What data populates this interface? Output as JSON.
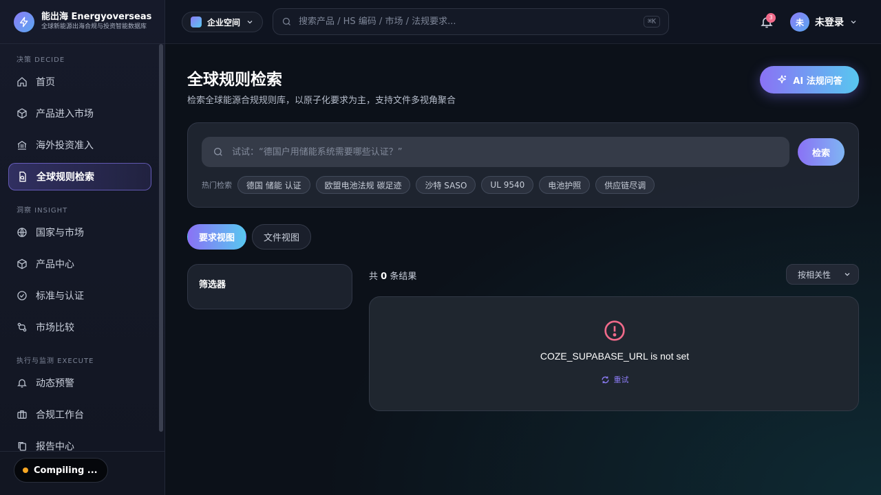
{
  "brand": {
    "name": "能出海 Energyoverseas",
    "subtitle": "全球新能源出海合规与投资智能数据库"
  },
  "sidebar": {
    "sections": [
      {
        "label": "决策 DECIDE",
        "items": [
          {
            "label": "首页",
            "icon": "home-icon"
          },
          {
            "label": "产品进入市场",
            "icon": "box-icon"
          },
          {
            "label": "海外投资准入",
            "icon": "bank-icon"
          },
          {
            "label": "全球规则检索",
            "icon": "document-search-icon",
            "active": true
          }
        ]
      },
      {
        "label": "洞察 INSIGHT",
        "items": [
          {
            "label": "国家与市场",
            "icon": "globe-icon"
          },
          {
            "label": "产品中心",
            "icon": "cube-icon"
          },
          {
            "label": "标准与认证",
            "icon": "check-circle-icon"
          },
          {
            "label": "市场比较",
            "icon": "compare-icon"
          }
        ]
      },
      {
        "label": "执行与监测 EXECUTE",
        "items": [
          {
            "label": "动态预警",
            "icon": "bell-icon"
          },
          {
            "label": "合规工作台",
            "icon": "briefcase-icon"
          },
          {
            "label": "报告中心",
            "icon": "copy-icon"
          }
        ]
      }
    ],
    "compiling_label": "Compiling ..."
  },
  "topbar": {
    "workspace_label": "企业空间",
    "search_placeholder": "搜索产品 / HS 编码 / 市场 / 法规要求...",
    "shortcut": "⌘K",
    "notification_count": "3",
    "user_avatar": "未",
    "user_name": "未登录"
  },
  "main": {
    "title": "全球规则检索",
    "subtitle": "检索全球能源合规规则库，以原子化要求为主，支持文件多视角聚合",
    "ai_button": "AI 法规问答",
    "search_placeholder": "试试：“德国户用储能系统需要哪些认证？”",
    "search_button": "检索",
    "hot_label": "热门检索",
    "hot_tags": [
      "德国 储能 认证",
      "欧盟电池法规 碳足迹",
      "沙特 SASO",
      "UL 9540",
      "电池护照",
      "供应链尽调"
    ],
    "tabs": [
      {
        "label": "要求视图",
        "active": true
      },
      {
        "label": "文件视图",
        "active": false
      }
    ],
    "filter_title": "筛选器",
    "result_prefix": "共",
    "result_count": "0",
    "result_suffix": "条结果",
    "sort_label": "按相关性",
    "error_message": "COZE_SUPABASE_URL is not set",
    "retry_label": "重试"
  },
  "colors": {
    "accent": "#8a72f5",
    "accent_2": "#58c7f0",
    "error": "#f06a8a"
  }
}
